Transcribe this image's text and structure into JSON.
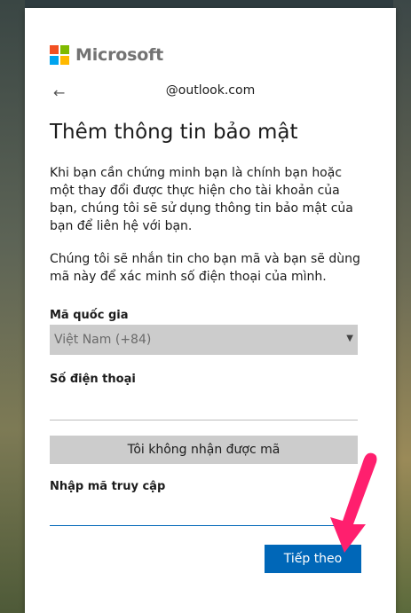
{
  "brand": {
    "name": "Microsoft"
  },
  "header": {
    "back_icon": "←",
    "email": "@outlook.com"
  },
  "title": "Thêm thông tin bảo mật",
  "paragraphs": {
    "p1": "Khi bạn cần chứng minh bạn là chính bạn hoặc một thay đổi được thực hiện cho tài khoản của bạn, chúng tôi sẽ sử dụng thông tin bảo mật của bạn để liên hệ với bạn.",
    "p2": "Chúng tôi sẽ nhắn tin cho bạn mã và bạn sẽ dùng mã này để xác minh số điện thoại của mình."
  },
  "country": {
    "label": "Mã quốc gia",
    "value": "Việt Nam (+84)",
    "caret": "▼"
  },
  "phone": {
    "label": "Số điện thoại",
    "value": ""
  },
  "no_code_button": "Tôi không nhận được mã",
  "access_code": {
    "label": "Nhập mã truy cập",
    "value": ""
  },
  "next_button": "Tiếp theo",
  "colors": {
    "accent": "#0067b8",
    "annotation_arrow": "#ff1f6e"
  }
}
